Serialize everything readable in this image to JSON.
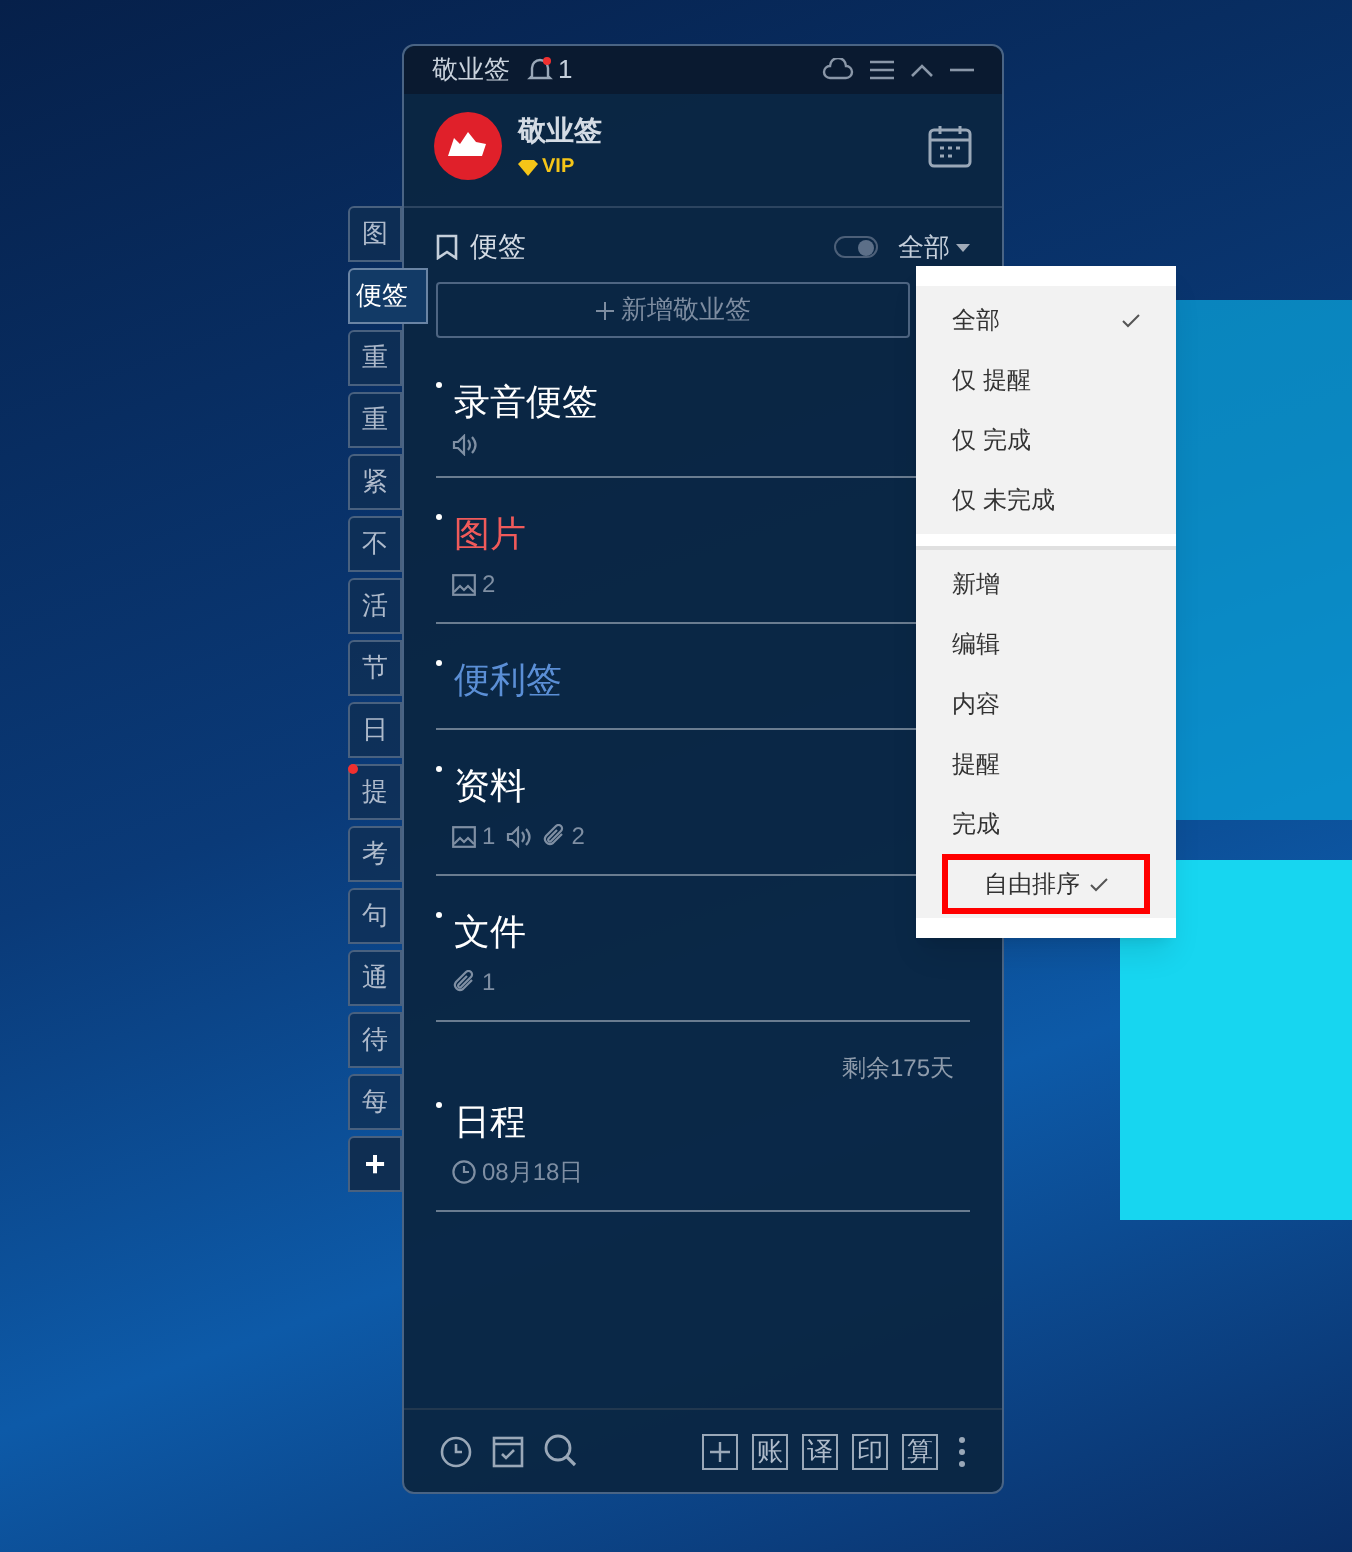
{
  "side_tabs": [
    {
      "label": "图",
      "selected": false,
      "dot": false
    },
    {
      "label": "便签",
      "selected": true,
      "dot": false
    },
    {
      "label": "重",
      "selected": false,
      "dot": false
    },
    {
      "label": "重",
      "selected": false,
      "dot": false
    },
    {
      "label": "紧",
      "selected": false,
      "dot": false
    },
    {
      "label": "不",
      "selected": false,
      "dot": false
    },
    {
      "label": "活",
      "selected": false,
      "dot": false
    },
    {
      "label": "节",
      "selected": false,
      "dot": false
    },
    {
      "label": "日",
      "selected": false,
      "dot": false
    },
    {
      "label": "提",
      "selected": false,
      "dot": true
    },
    {
      "label": "考",
      "selected": false,
      "dot": false
    },
    {
      "label": "句",
      "selected": false,
      "dot": false
    },
    {
      "label": "通",
      "selected": false,
      "dot": false
    },
    {
      "label": "待",
      "selected": false,
      "dot": false
    },
    {
      "label": "每",
      "selected": false,
      "dot": false
    }
  ],
  "add_tab": "+",
  "window": {
    "title": "敬业签",
    "notification_count": "1"
  },
  "profile": {
    "name": "敬业签",
    "badge": "VIP"
  },
  "section": {
    "title": "便签",
    "toggle_on": true,
    "filter": "全部"
  },
  "new_button": "新增敬业签",
  "notes": [
    {
      "title": "录音便签",
      "color": "#ffffff",
      "meta": [
        {
          "kind": "audio"
        }
      ]
    },
    {
      "title": "图片",
      "color": "#f05a5a",
      "meta": [
        {
          "kind": "image",
          "count": "2"
        }
      ]
    },
    {
      "title": "便利签",
      "color": "#5b8fd6"
    },
    {
      "title": "资料",
      "color": "#ffffff",
      "meta": [
        {
          "kind": "image",
          "count": "1"
        },
        {
          "kind": "audio"
        },
        {
          "kind": "attachment",
          "count": "2"
        }
      ]
    },
    {
      "title": "文件",
      "color": "#ffffff",
      "meta": [
        {
          "kind": "attachment",
          "count": "1"
        }
      ]
    },
    {
      "title": "日程",
      "color": "#ffffff",
      "remaining": "剩余175天",
      "meta": [
        {
          "kind": "date",
          "count": "08月18日"
        }
      ]
    }
  ],
  "toolbar": [
    "账",
    "译",
    "印",
    "算"
  ],
  "menu": {
    "sections": [
      [
        {
          "label": "全部",
          "checked": true,
          "highlighted": false
        },
        {
          "label": "仅 提醒",
          "checked": false,
          "highlighted": false
        },
        {
          "label": "仅 完成",
          "checked": false,
          "highlighted": false
        },
        {
          "label": "仅 未完成",
          "checked": false,
          "highlighted": false
        }
      ],
      [
        {
          "label": "新增",
          "checked": false,
          "highlighted": false
        },
        {
          "label": "编辑",
          "checked": false,
          "highlighted": false
        },
        {
          "label": "内容",
          "checked": false,
          "highlighted": false
        },
        {
          "label": "提醒",
          "checked": false,
          "highlighted": false
        },
        {
          "label": "完成",
          "checked": false,
          "highlighted": false
        },
        {
          "label": "自由排序",
          "checked": true,
          "highlighted": true
        }
      ]
    ]
  }
}
